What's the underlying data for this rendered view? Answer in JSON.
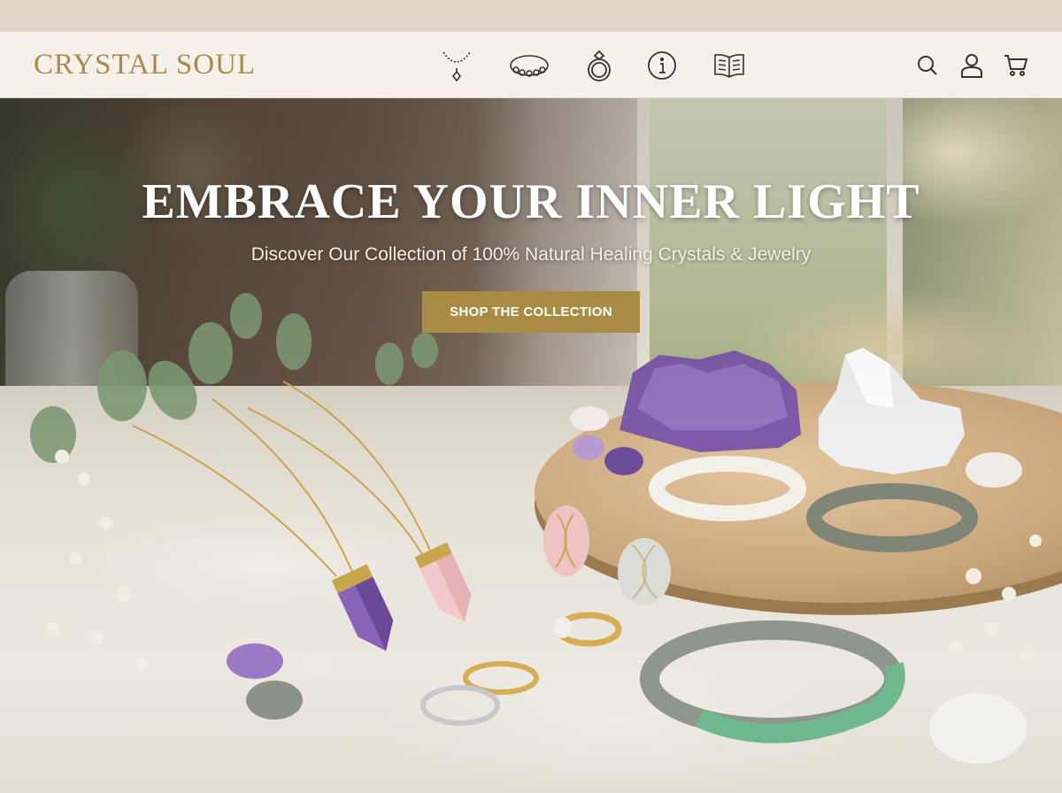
{
  "brand": {
    "name": "CRYSTAL SOUL",
    "accent_color": "#a98b43"
  },
  "nav": {
    "categories": [
      {
        "icon": "necklace-icon"
      },
      {
        "icon": "bracelet-icon"
      },
      {
        "icon": "ring-icon"
      },
      {
        "icon": "info-icon"
      },
      {
        "icon": "book-icon"
      }
    ],
    "actions": [
      {
        "icon": "search-icon"
      },
      {
        "icon": "account-icon"
      },
      {
        "icon": "cart-icon"
      }
    ]
  },
  "hero": {
    "title": "EMBRACE YOUR INNER LIGHT",
    "subtitle": "Discover Our Collection of 100% Natural Healing Crystals & Jewelry",
    "cta_label": "SHOP THE COLLECTION"
  }
}
